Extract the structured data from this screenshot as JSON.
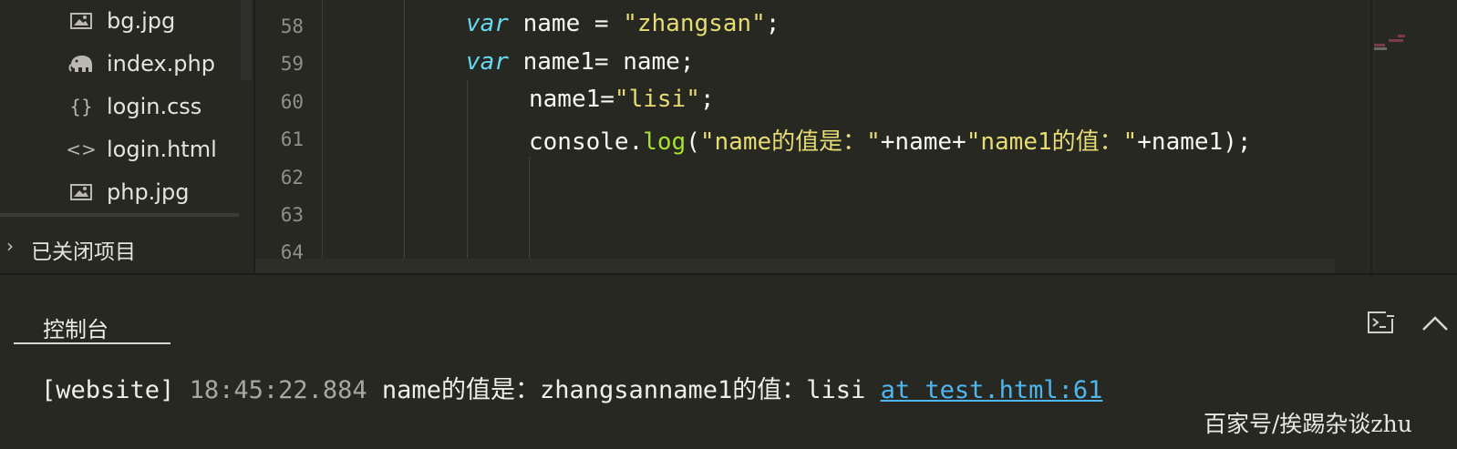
{
  "sidebar": {
    "files": [
      {
        "name": "bg.jpg",
        "icon": "image-icon"
      },
      {
        "name": "index.php",
        "icon": "php-elephant-icon"
      },
      {
        "name": "login.css",
        "icon": "braces-icon"
      },
      {
        "name": "login.html",
        "icon": "angle-brackets-icon"
      },
      {
        "name": "php.jpg",
        "icon": "image-icon"
      }
    ],
    "closed_projects_label": "已关闭项目"
  },
  "editor": {
    "line_numbers": [
      "58",
      "59",
      "60",
      "61",
      "62",
      "63",
      "64"
    ],
    "lines": {
      "l58": {
        "kw": "var",
        "a": " name = ",
        "s": "\"zhangsan\"",
        "b": ";"
      },
      "l59": {
        "kw": "var",
        "a": " name1= name;"
      },
      "l60": {
        "a": "name1=",
        "s": "\"lisi\"",
        "b": ";"
      },
      "l61": {
        "obj": "console.",
        "fn": "log",
        "p": "(",
        "s1": "\"name的值是：\"",
        "m": "+name+",
        "s2": "\"name1的值：\"",
        "end": "+name1);"
      }
    },
    "colors": {
      "keyword": "#66d9ef",
      "string": "#e6db74",
      "function": "#a6e22e",
      "text": "#f8f8f2"
    }
  },
  "console": {
    "tab_label": "控制台",
    "log": {
      "source": "[website]",
      "time": "18:45:22.884",
      "message": "name的值是：zhangsanname1的值：lisi",
      "link": "at test.html:61"
    },
    "open_icon": "open-in-panel-icon",
    "collapse_icon": "chevron-up-icon",
    "link_color": "#4fb6ee"
  },
  "watermark": "百家号/挨踢杂谈zhu"
}
